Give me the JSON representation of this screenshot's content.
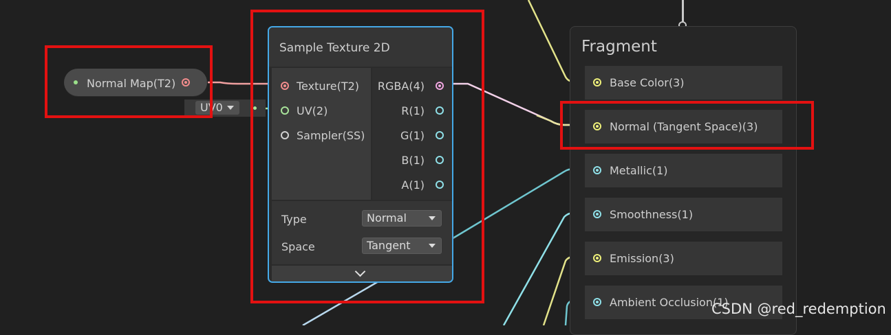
{
  "property_node": {
    "label": "Normal Map(T2)"
  },
  "uv_input": {
    "value": "UV0"
  },
  "sample_texture_node": {
    "title": "Sample Texture 2D",
    "inputs": [
      "Texture(T2)",
      "UV(2)",
      "Sampler(SS)"
    ],
    "outputs": [
      "RGBA(4)",
      "R(1)",
      "G(1)",
      "B(1)",
      "A(1)"
    ],
    "settings": {
      "type_label": "Type",
      "type_value": "Normal",
      "space_label": "Space",
      "space_value": "Tangent"
    }
  },
  "fragment": {
    "title": "Fragment",
    "ports": [
      {
        "label": "Base Color(3)",
        "color": "#eef07a"
      },
      {
        "label": "Normal (Tangent Space)(3)",
        "color": "#eef07a"
      },
      {
        "label": "Metallic(1)",
        "color": "#8fe0e8"
      },
      {
        "label": "Smoothness(1)",
        "color": "#8fe0e8"
      },
      {
        "label": "Emission(3)",
        "color": "#eef07a"
      },
      {
        "label": "Ambient Occlusion(1)",
        "color": "#8fe0e8"
      }
    ]
  },
  "highlight_color": "#e31111",
  "selection_color": "#45a9e8",
  "watermark": "CSDN @red_redemption"
}
